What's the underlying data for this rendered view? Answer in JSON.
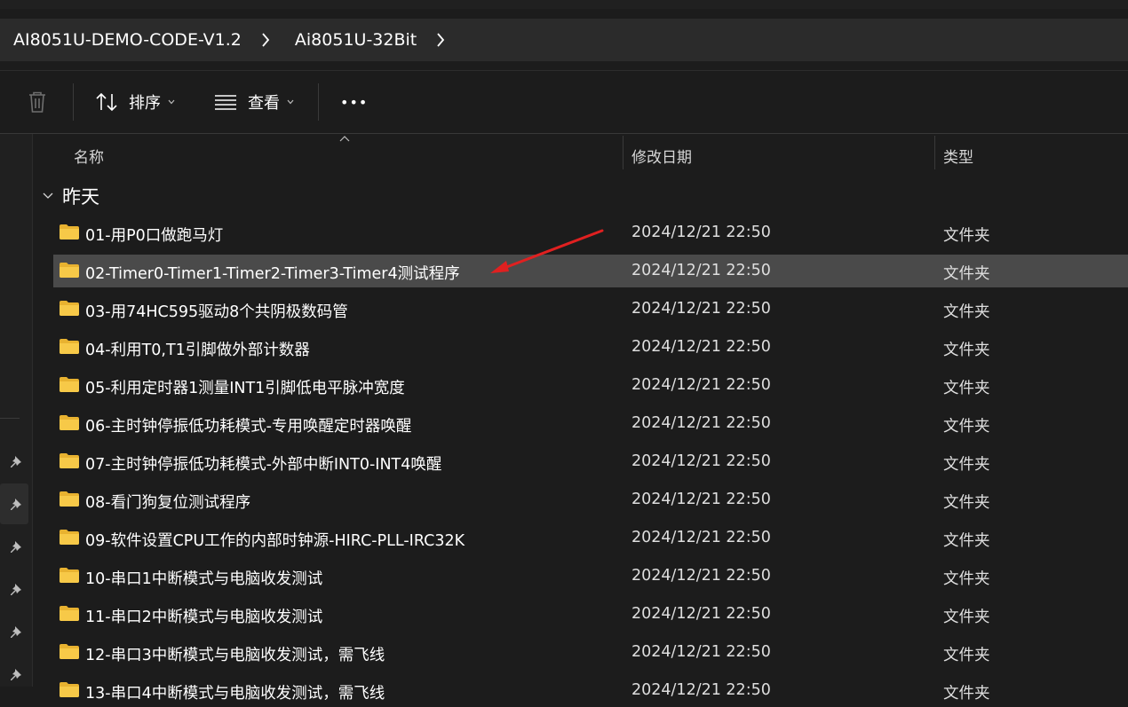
{
  "breadcrumb": {
    "items": [
      "AI8051U-DEMO-CODE-V1.2",
      "Ai8051U-32Bit"
    ]
  },
  "toolbar": {
    "sort_label": "排序",
    "view_label": "查看",
    "more_label": "•••"
  },
  "columns": {
    "name": "名称",
    "date": "修改日期",
    "type": "类型"
  },
  "group": {
    "label": "昨天"
  },
  "files": [
    {
      "name": "01-用P0口做跑马灯",
      "date": "2024/12/21 22:50",
      "type": "文件夹"
    },
    {
      "name": "02-Timer0-Timer1-Timer2-Timer3-Timer4测试程序",
      "date": "2024/12/21 22:50",
      "type": "文件夹",
      "selected": true
    },
    {
      "name": "03-用74HC595驱动8个共阴极数码管",
      "date": "2024/12/21 22:50",
      "type": "文件夹"
    },
    {
      "name": "04-利用T0,T1引脚做外部计数器",
      "date": "2024/12/21 22:50",
      "type": "文件夹"
    },
    {
      "name": "05-利用定时器1测量INT1引脚低电平脉冲宽度",
      "date": "2024/12/21 22:50",
      "type": "文件夹"
    },
    {
      "name": "06-主时钟停振低功耗模式-专用唤醒定时器唤醒",
      "date": "2024/12/21 22:50",
      "type": "文件夹"
    },
    {
      "name": "07-主时钟停振低功耗模式-外部中断INT0-INT4唤醒",
      "date": "2024/12/21 22:50",
      "type": "文件夹"
    },
    {
      "name": "08-看门狗复位测试程序",
      "date": "2024/12/21 22:50",
      "type": "文件夹"
    },
    {
      "name": "09-软件设置CPU工作的内部时钟源-HIRC-PLL-IRC32K",
      "date": "2024/12/21 22:50",
      "type": "文件夹"
    },
    {
      "name": "10-串口1中断模式与电脑收发测试",
      "date": "2024/12/21 22:50",
      "type": "文件夹"
    },
    {
      "name": "11-串口2中断模式与电脑收发测试",
      "date": "2024/12/21 22:50",
      "type": "文件夹"
    },
    {
      "name": "12-串口3中断模式与电脑收发测试，需飞线",
      "date": "2024/12/21 22:50",
      "type": "文件夹"
    },
    {
      "name": "13-串口4中断模式与电脑收发测试，需飞线",
      "date": "2024/12/21 22:50",
      "type": "文件夹"
    }
  ],
  "colors": {
    "background": "#1c1c1c",
    "selection": "#4a4a4a",
    "folder": "#f5c242",
    "annotation_arrow": "#e02020"
  }
}
